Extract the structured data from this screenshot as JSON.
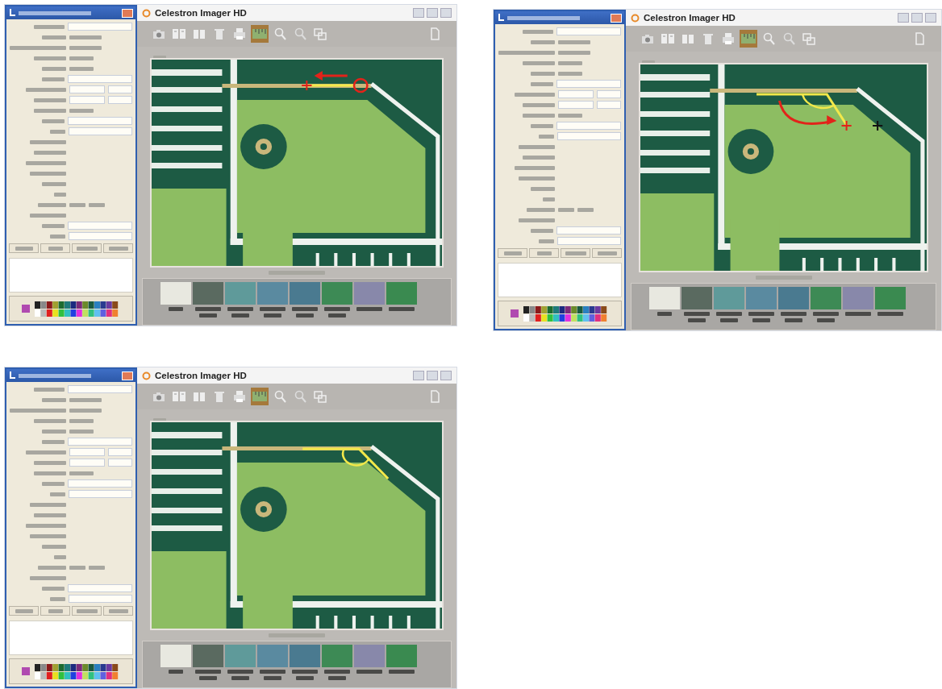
{
  "panels": [
    {
      "title": "Celestron Imager HD",
      "annotation": {
        "kind": "move-point"
      },
      "toolbar": [
        {
          "kind": "camera",
          "selected": false
        },
        {
          "kind": "book",
          "selected": false
        },
        {
          "kind": "pages",
          "selected": false
        },
        {
          "kind": "trash",
          "selected": false
        },
        {
          "kind": "printer",
          "selected": false
        },
        {
          "kind": "measure",
          "selected": true
        },
        {
          "kind": "zoom-in",
          "selected": false
        },
        {
          "kind": "zoom-out",
          "selected": false
        },
        {
          "kind": "copy",
          "selected": false
        },
        {
          "kind": "document",
          "selected": false
        }
      ]
    },
    {
      "title": "Celestron Imager HD",
      "annotation": {
        "kind": "rotate-arm"
      },
      "toolbar": [
        {
          "kind": "camera",
          "selected": false
        },
        {
          "kind": "book",
          "selected": false
        },
        {
          "kind": "pages",
          "selected": false
        },
        {
          "kind": "trash",
          "selected": false
        },
        {
          "kind": "printer",
          "selected": false
        },
        {
          "kind": "measure",
          "selected": true
        },
        {
          "kind": "zoom-in",
          "selected": false
        },
        {
          "kind": "zoom-out",
          "selected": false
        },
        {
          "kind": "copy",
          "selected": false
        },
        {
          "kind": "document",
          "selected": false
        }
      ]
    },
    {
      "title": "Celestron Imager HD",
      "annotation": {
        "kind": "angle"
      },
      "toolbar": [
        {
          "kind": "camera",
          "selected": false
        },
        {
          "kind": "book",
          "selected": false
        },
        {
          "kind": "pages",
          "selected": false
        },
        {
          "kind": "trash",
          "selected": false
        },
        {
          "kind": "printer",
          "selected": false
        },
        {
          "kind": "measure",
          "selected": true
        },
        {
          "kind": "zoom-in",
          "selected": false
        },
        {
          "kind": "zoom-out",
          "selected": false
        },
        {
          "kind": "copy",
          "selected": false
        },
        {
          "kind": "document",
          "selected": false
        }
      ]
    }
  ]
}
